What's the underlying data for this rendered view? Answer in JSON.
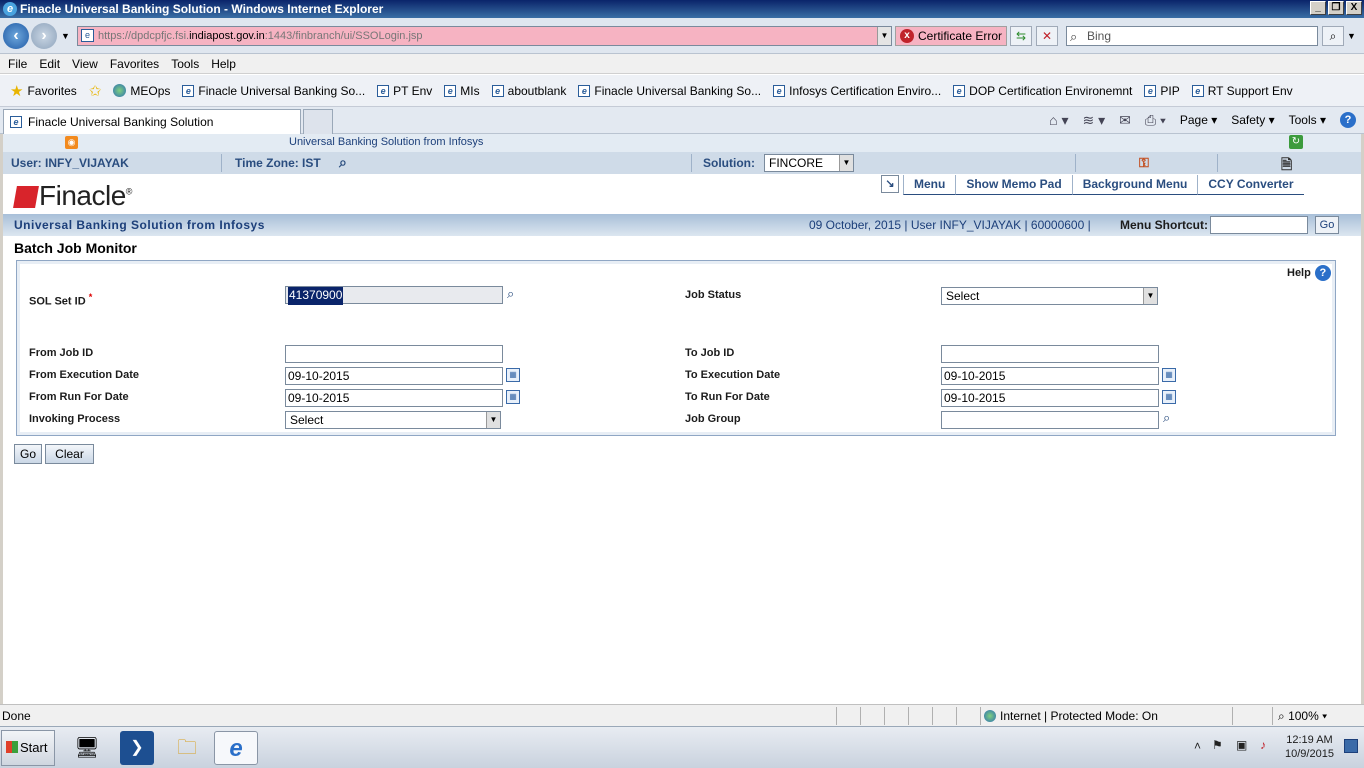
{
  "window": {
    "title": "Finacle Universal Banking Solution - Windows Internet Explorer",
    "controls": [
      "_",
      "❐",
      "X"
    ]
  },
  "browser": {
    "url_prefix": "https://dpdcpfjc.fsi.",
    "url_domain": "indiapost.gov.in",
    "url_suffix": ":1443/finbranch/ui/SSOLogin.jsp",
    "cert_error": "Certificate Error",
    "search_placeholder": "Bing",
    "menu": [
      "File",
      "Edit",
      "View",
      "Favorites",
      "Tools",
      "Help"
    ],
    "favorites_label": "Favorites",
    "favorites": [
      "MEOps",
      "Finacle Universal Banking So...",
      "PT Env",
      "MIs",
      "aboutblank",
      "Finacle Universal Banking So...",
      "Infosys Certification Enviro...",
      "DOP Certification Environemnt",
      "PIP",
      "RT Support Env"
    ],
    "tab_title": "Finacle Universal Banking Solution",
    "cmd": {
      "page": "Page",
      "safety": "Safety",
      "tools": "Tools"
    }
  },
  "app": {
    "banner_title": "Universal Banking Solution from Infosys",
    "user_label": "User: INFY_VIJAYAK",
    "timezone_label": "Time Zone:",
    "timezone_value": "IST",
    "solution_label": "Solution:",
    "solution_value": "FINCORE",
    "logo_text": "Finacle",
    "top_menu": [
      "Menu",
      "Show Memo Pad",
      "Background Menu",
      "CCY Converter"
    ],
    "sub_banner": "Universal Banking Solution from Infosys",
    "info_line": "09 October, 2015  |  User  INFY_VIJAYAK  |  60000600  |",
    "menu_shortcut_label": "Menu Shortcut:",
    "shortcut_go": "Go"
  },
  "form": {
    "page_title": "Batch Job Monitor",
    "help_label": "Help",
    "sol_set_id_label": "SOL Set ID",
    "required_mark": "*",
    "sol_set_id_value": "41370900",
    "job_status_label": "Job Status",
    "job_status_value": "Select",
    "from_job_id_label": "From Job ID",
    "from_job_id_value": "",
    "to_job_id_label": "To Job ID",
    "to_job_id_value": "",
    "from_exec_date_label": "From Execution Date",
    "from_exec_date_value": "09-10-2015",
    "to_exec_date_label": "To Execution Date",
    "to_exec_date_value": "09-10-2015",
    "from_run_date_label": "From Run For Date",
    "from_run_date_value": "09-10-2015",
    "to_run_date_label": "To Run For Date",
    "to_run_date_value": "09-10-2015",
    "invoking_process_label": "Invoking Process",
    "invoking_process_value": "Select",
    "job_group_label": "Job Group",
    "job_group_value": "",
    "go_button": "Go",
    "clear_button": "Clear"
  },
  "status": {
    "text": "Done",
    "zone": "Internet | Protected Mode: On",
    "zoom": "100%"
  },
  "taskbar": {
    "start": "Start",
    "time": "12:19 AM",
    "date": "10/9/2015"
  }
}
